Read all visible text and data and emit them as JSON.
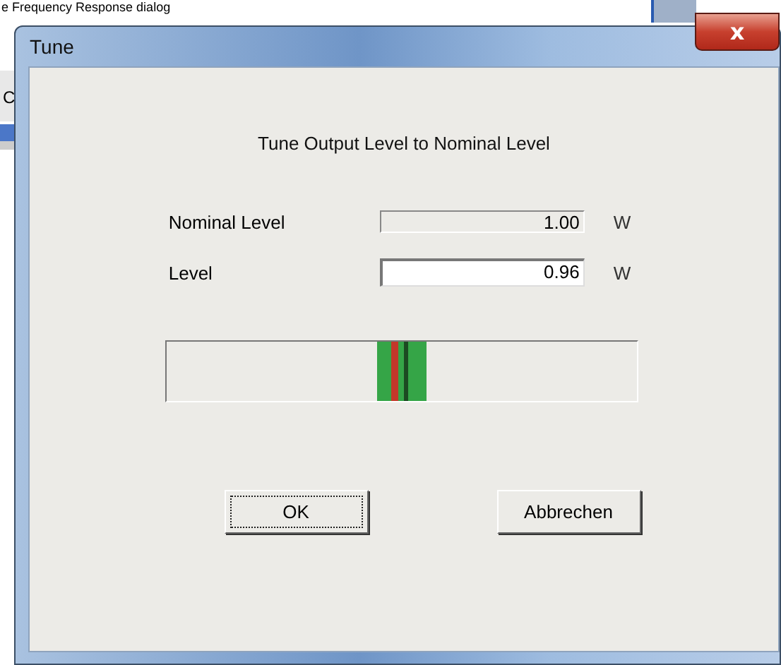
{
  "background_window": {
    "title_fragment": "e Frequency Response dialog",
    "side_fragment": "C"
  },
  "window": {
    "title": "Tune",
    "close_label": "x"
  },
  "heading": "Tune Output Level to Nominal Level",
  "fields": [
    {
      "label": "Nominal Level",
      "value": "1.00",
      "unit": "W",
      "editable": false
    },
    {
      "label": "Level",
      "value": "0.96",
      "unit": "W",
      "editable": true
    }
  ],
  "meter": {
    "level": 0.478
  },
  "buttons": [
    {
      "label": "OK",
      "focused": true
    },
    {
      "label": "Abbrechen",
      "focused": false
    }
  ]
}
